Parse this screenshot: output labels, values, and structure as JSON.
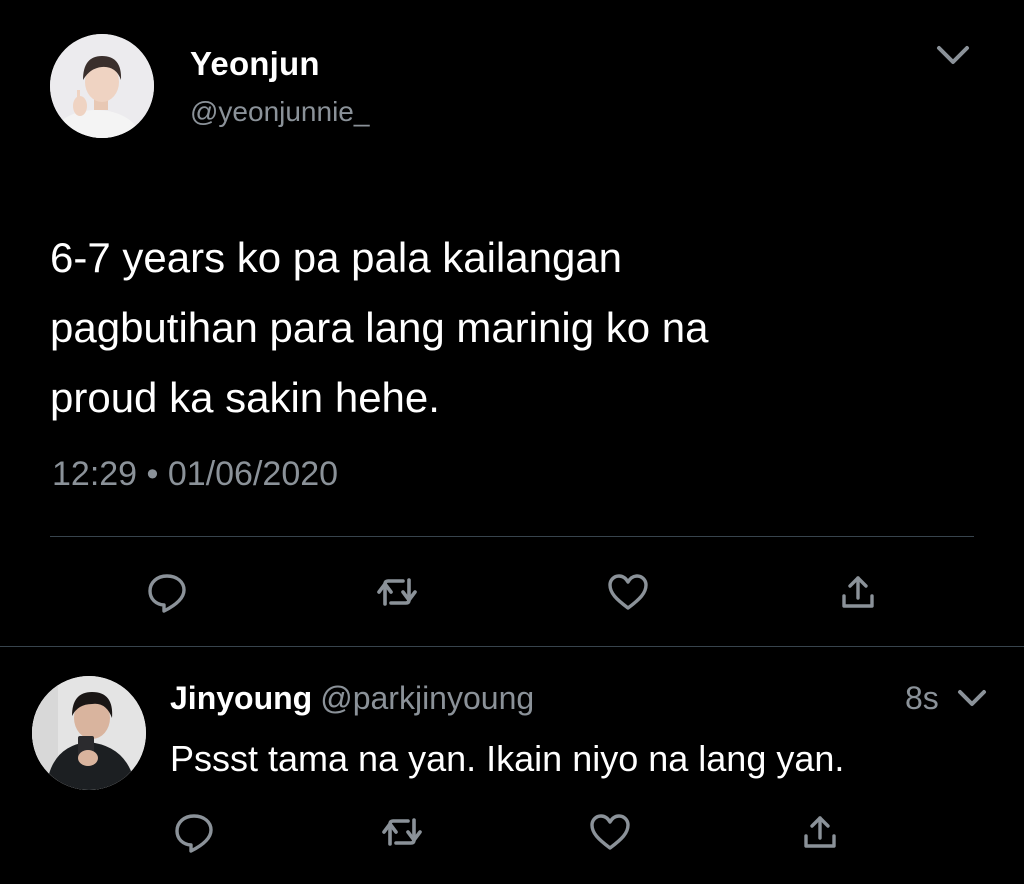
{
  "main_tweet": {
    "display_name": "Yeonjun",
    "handle": "@yeonjunnie_",
    "text": "6-7 years ko pa pala kailangan\npagbutihan para lang marinig ko na\nproud ka sakin hehe.",
    "timestamp": "12:29 • 01/06/2020",
    "icons": {
      "more": "chevron-down-icon",
      "reply": "reply-icon",
      "retweet": "retweet-icon",
      "like": "heart-icon",
      "share": "share-icon"
    }
  },
  "reply_tweet": {
    "display_name": "Jinyoung",
    "handle": "@parkjinyoung",
    "time_ago": "8s",
    "text": "Pssst tama na yan. Ikain niyo na lang yan.",
    "icons": {
      "more": "chevron-down-icon",
      "reply": "reply-icon",
      "retweet": "retweet-icon",
      "like": "heart-icon",
      "share": "share-icon"
    }
  },
  "colors": {
    "background": "#000000",
    "primary_text": "#ffffff",
    "secondary_text": "#8b9299",
    "divider": "#38444d",
    "icon": "#8b9299"
  }
}
